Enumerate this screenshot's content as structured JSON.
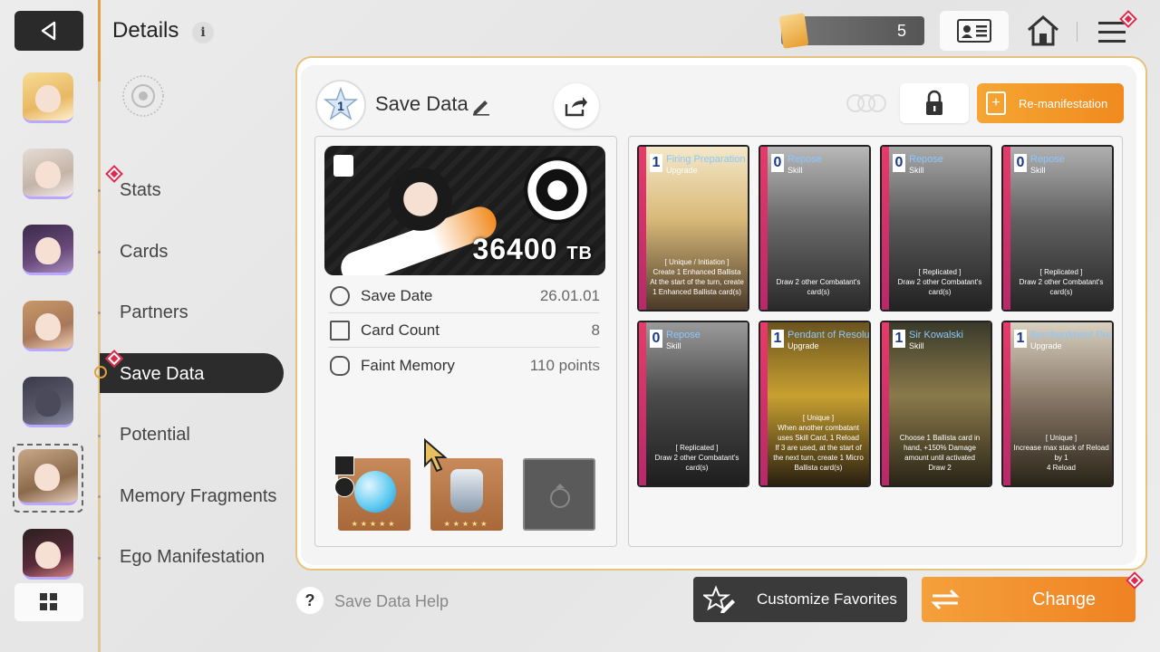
{
  "header": {
    "title": "Details",
    "info_icon": "i",
    "currency_value": "5"
  },
  "menu": {
    "items": [
      {
        "label": "Stats"
      },
      {
        "label": "Cards"
      },
      {
        "label": "Partners"
      },
      {
        "label": "Save Data"
      },
      {
        "label": "Potential"
      },
      {
        "label": "Memory Fragments"
      },
      {
        "label": "Ego Manifestation"
      }
    ],
    "active": "Save Data"
  },
  "save_data": {
    "star_level": "1",
    "title": "Save Data",
    "tb_value": "36400",
    "tb_unit": "TB",
    "remanifestation_label": "Re-manifestation",
    "info": [
      {
        "label": "Save Date",
        "value": "26.01.01"
      },
      {
        "label": "Card Count",
        "value": "8"
      },
      {
        "label": "Faint Memory",
        "value": "110 points"
      }
    ]
  },
  "cards": [
    {
      "cost": "1",
      "name": "Firing Preparation",
      "type": "Upgrade",
      "desc_lines": [
        "[ Unique / Initiation ]",
        "Create 1 Enhanced Ballista",
        "At the start of the turn, create 1 Enhanced Ballista card(s)"
      ]
    },
    {
      "cost": "0",
      "name": "Repose",
      "type": "Skill",
      "desc_lines": [
        "Draw 2 other Combatant's card(s)"
      ]
    },
    {
      "cost": "0",
      "name": "Repose",
      "type": "Skill",
      "desc_lines": [
        "[ Replicated ]",
        "Draw 2 other Combatant's card(s)"
      ]
    },
    {
      "cost": "0",
      "name": "Repose",
      "type": "Skill",
      "desc_lines": [
        "[ Replicated ]",
        "Draw 2 other Combatant's card(s)"
      ]
    },
    {
      "cost": "0",
      "name": "Repose",
      "type": "Skill",
      "desc_lines": [
        "[ Replicated ]",
        "Draw 2 other Combatant's card(s)"
      ]
    },
    {
      "cost": "1",
      "name": "Pendant of Resolution",
      "type": "Upgrade",
      "desc_lines": [
        "[ Unique ]",
        "When another combatant uses Skill Card, 1 Reload",
        "If 3 are used, at the start of the next turn, create 1 Micro Ballista card(s)"
      ]
    },
    {
      "cost": "1",
      "name": "Sir Kowalski",
      "type": "Skill",
      "desc_lines": [
        "Choose 1 Ballista card in hand, +150% Damage amount until activated",
        "Draw 2"
      ]
    },
    {
      "cost": "1",
      "name": "Bombardment Prep",
      "type": "Upgrade",
      "desc_lines": [
        "[ Unique ]",
        "Increase max stack of Reload by 1",
        "4 Reload"
      ]
    }
  ],
  "footer": {
    "help_label": "Save Data Help",
    "favorites_label": "Customize Favorites",
    "change_label": "Change"
  },
  "colors": {
    "accent_orange": "#f08a1e",
    "dark_button": "#2c2c2c",
    "alert_red": "#e0284a",
    "card_edge": "#e83a6a"
  },
  "icons": {
    "back": "back-arrow-icon",
    "info": "info-icon",
    "id_card": "id-card-icon",
    "home": "home-icon",
    "menu": "hamburger-menu-icon",
    "edit": "pencil-icon",
    "share": "share-icon",
    "lock": "lock-icon",
    "help": "question-icon",
    "favorites": "star-pencil-icon",
    "swap": "swap-arrows-icon"
  }
}
